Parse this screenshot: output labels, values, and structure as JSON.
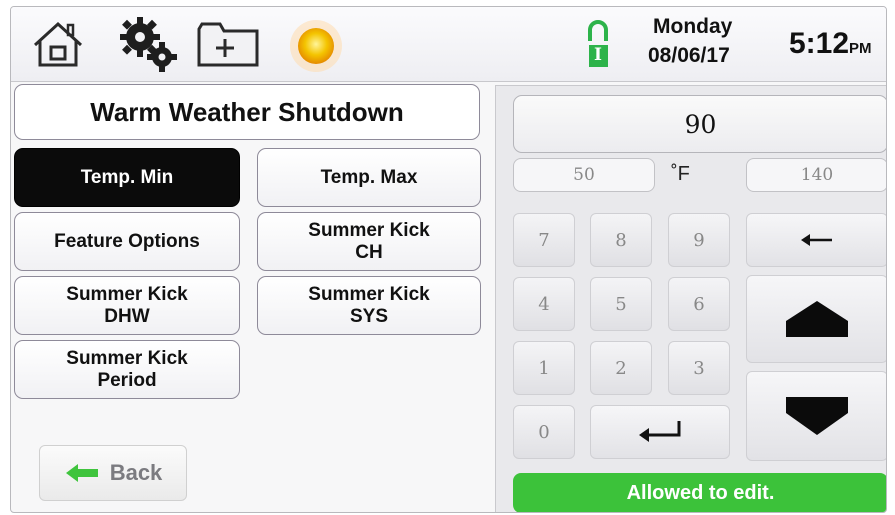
{
  "topbar": {
    "icons": [
      "home-icon",
      "gear-icon",
      "add-folder-icon",
      "sun-icon",
      "lock-status-icon"
    ],
    "lock_badge": "I",
    "day": "Monday",
    "date": "08/06/17",
    "time": "5:12",
    "ampm": "PM"
  },
  "left": {
    "title": "Warm Weather Shutdown",
    "buttons": [
      {
        "line1": "Temp. Min",
        "line2": ""
      },
      {
        "line1": "Temp. Max",
        "line2": ""
      },
      {
        "line1": "Feature Options",
        "line2": ""
      },
      {
        "line1": "Summer Kick",
        "line2": "CH"
      },
      {
        "line1": "Summer Kick",
        "line2": "DHW"
      },
      {
        "line1": "Summer Kick",
        "line2": "SYS"
      },
      {
        "line1": "Summer Kick",
        "line2": "Period"
      }
    ],
    "back_label": "Back"
  },
  "keypad": {
    "value": "90",
    "min": "50",
    "unit": "˚F",
    "max": "140",
    "digits": [
      "7",
      "8",
      "9",
      "4",
      "5",
      "6",
      "1",
      "2",
      "3",
      "0"
    ],
    "status": "Allowed to edit."
  },
  "colors": {
    "active_button": "#0b0b0b",
    "status_green": "#3cc23a",
    "lock_green": "#2db34a",
    "back_arrow": "#3fc43d"
  }
}
